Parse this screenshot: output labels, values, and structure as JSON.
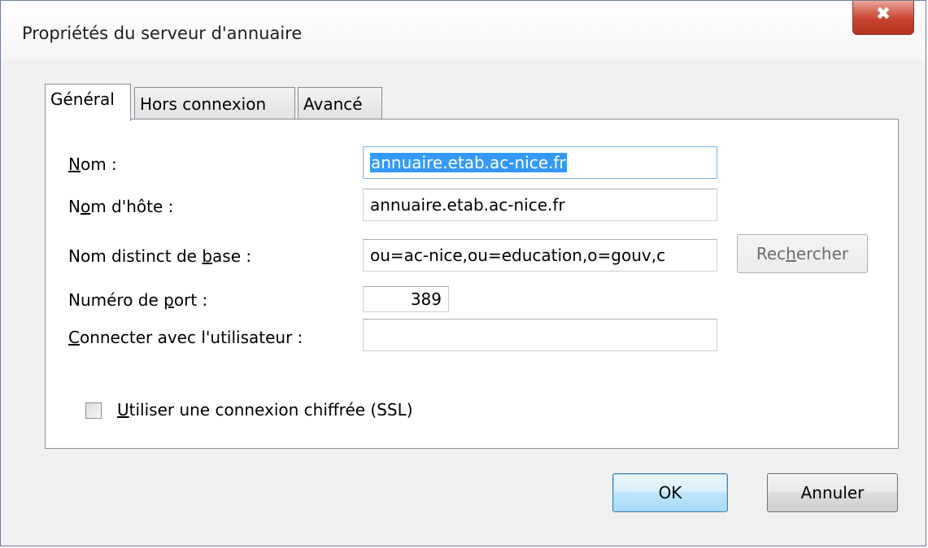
{
  "window": {
    "title": "Propriétés du serveur d'annuaire",
    "close_glyph": "✖"
  },
  "tabs": [
    {
      "label": "Général",
      "active": true
    },
    {
      "label": "Hors connexion",
      "active": false
    },
    {
      "label": "Avancé",
      "active": false
    }
  ],
  "general": {
    "name_label_u": "N",
    "name_label_rest": "om :",
    "name_value": "annuaire.etab.ac-nice.fr",
    "host_label_pre": "N",
    "host_label_u": "o",
    "host_label_rest": "m d'hôte :",
    "host_value": "annuaire.etab.ac-nice.fr",
    "basedn_label_pre": "Nom distinct de ",
    "basedn_label_u": "b",
    "basedn_label_rest": "ase :",
    "basedn_value": "ou=ac-nice,ou=education,o=gouv,c",
    "search_pre": "Rec",
    "search_u": "h",
    "search_rest": "ercher",
    "port_label_pre": "Numéro de ",
    "port_label_u": "p",
    "port_label_rest": "ort :",
    "port_value": "389",
    "user_label_u": "C",
    "user_label_rest": "onnecter avec l'utilisateur :",
    "user_value": "",
    "ssl_label_u": "U",
    "ssl_label_rest": "tiliser une connexion chiffrée (SSL)",
    "ssl_checked": false
  },
  "buttons": {
    "ok": "OK",
    "cancel": "Annuler"
  }
}
